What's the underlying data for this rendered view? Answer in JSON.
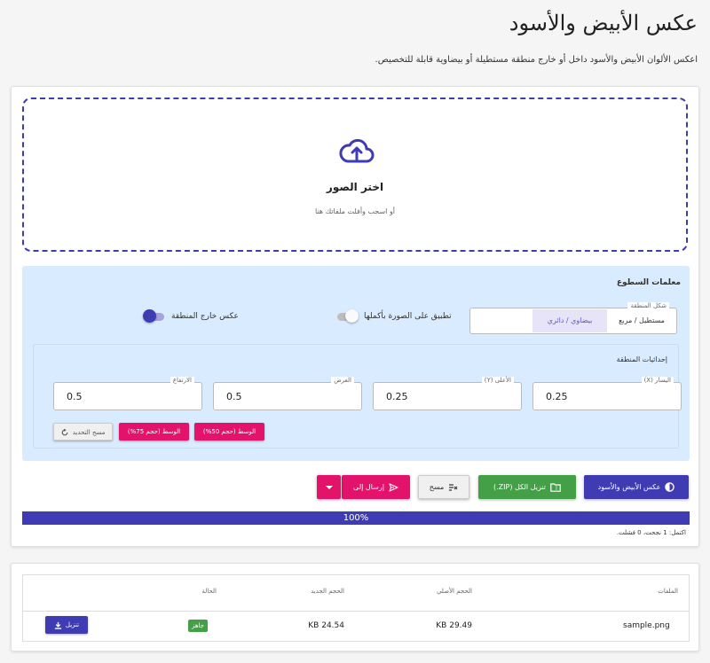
{
  "page": {
    "title": "عكس الأبيض والأسود",
    "subtitle": "اعكس الألوان الأبيض والأسود داخل أو خارج منطقة مستطيلة أو بيضاوية قابلة للتخصيص."
  },
  "dropzone": {
    "title": "اختر الصور",
    "hint": "أو اسحب وأفلت ملفاتك هنا"
  },
  "params": {
    "title": "معلمات السطوع",
    "shape": {
      "label": "شكل المنطقة",
      "options": [
        "مستطيل / مربع",
        "بيضاوي / دائري"
      ],
      "selected": "بيضاوي / دائري"
    },
    "apply_whole_label": "تطبيق على الصورة بأكملها",
    "apply_whole_on": false,
    "invert_outside_label": "عكس خارج المنطقة",
    "invert_outside_on": true,
    "coords_title": "إحداثيات المنطقة",
    "left_label": "اليسار (X)",
    "left_value": "0.25",
    "top_label": "الأعلى (Y)",
    "top_value": "0.25",
    "width_label": "العرض",
    "width_value": "0.5",
    "height_label": "الارتفاع",
    "height_value": "0.5",
    "preset_center_50": "الوسط (حجم 50%)",
    "preset_center_75": "الوسط (حجم 75%)",
    "reset_label": "مسح التحديد"
  },
  "actions": {
    "invert_label": "عكس الأبيض والأسود",
    "download_zip_label": "تنزيل الكل (ZIP.)",
    "clear_label": "مسح",
    "send_label": "إرسال إلى"
  },
  "progress": {
    "percent": 100,
    "label": "100%",
    "summary": "اكتمل: 1 نجحت، 0 فشلت."
  },
  "results": {
    "headers": {
      "files": "الملفات",
      "original_size": "الحجم الأصلي",
      "new_size": "الحجم الجديد",
      "status": "الحالة"
    },
    "rows": [
      {
        "file": "sample.png",
        "original_size": "29.49 KB",
        "new_size": "24.54 KB",
        "status": "جاهز",
        "download_label": "تنزيل"
      }
    ]
  },
  "colors": {
    "primary": "#3f3cb3",
    "accent": "#e3126b",
    "success": "#43a047",
    "panel": "#d9ebff"
  },
  "icons": [
    "cloud-upload-icon",
    "contrast-icon",
    "folder-zip-icon",
    "clear-icon",
    "send-icon",
    "chevron-down-icon",
    "reset-icon",
    "download-icon"
  ]
}
